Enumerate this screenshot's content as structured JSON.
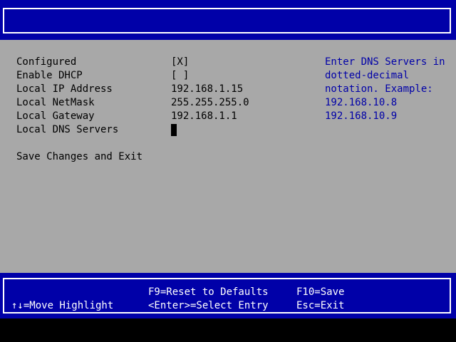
{
  "colors": {
    "header_bg": "#0000a8",
    "body_bg": "#a8a8a8",
    "help_text": "#0000a8",
    "footer_text": "#ffffff"
  },
  "fields": [
    {
      "label": "Configured",
      "value": "[X]"
    },
    {
      "label": "Enable DHCP",
      "value": "[ ]"
    },
    {
      "label": "Local IP Address",
      "value": "192.168.1.15"
    },
    {
      "label": "Local NetMask",
      "value": "255.255.255.0"
    },
    {
      "label": "Local Gateway",
      "value": "192.168.1.1"
    },
    {
      "label": "Local DNS Servers",
      "value": ""
    }
  ],
  "save_label": "Save Changes and Exit",
  "help": [
    "Enter DNS Servers in",
    "dotted-decimal",
    "notation. Example:",
    "192.168.10.8",
    "192.168.10.9"
  ],
  "footer": {
    "move": "↑↓=Move Highlight",
    "reset": "F9=Reset to Defaults",
    "select": "<Enter>=Select Entry",
    "save": "F10=Save",
    "exit": "Esc=Exit"
  }
}
